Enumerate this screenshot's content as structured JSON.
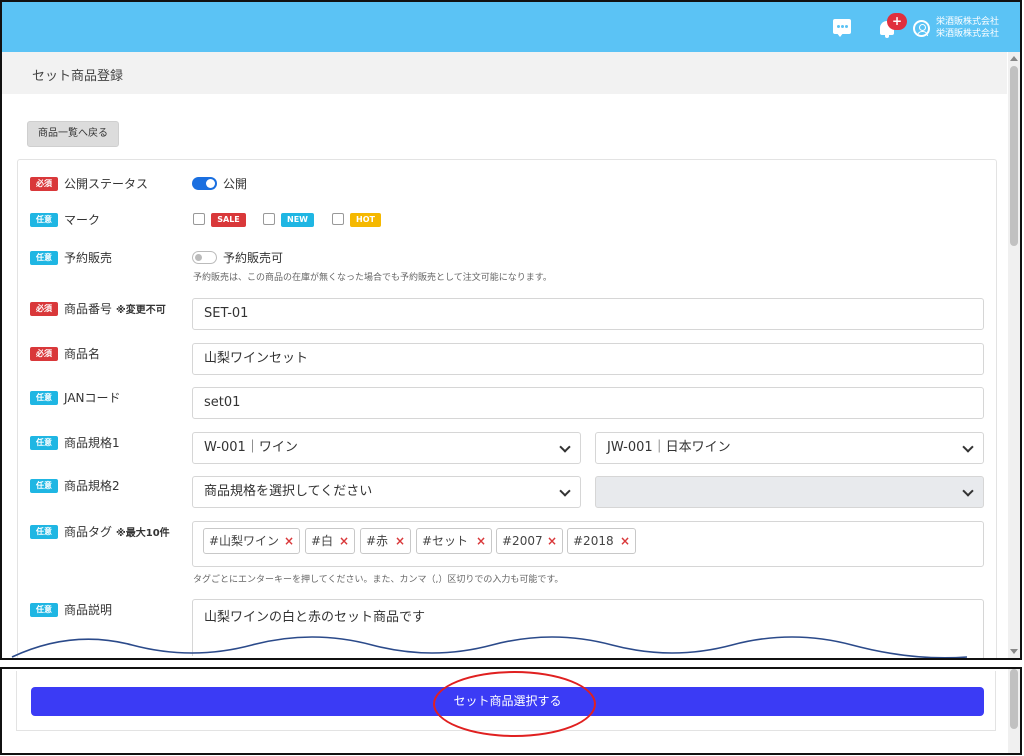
{
  "header": {
    "company_line1": "栄酒販株式会社",
    "company_line2": "栄酒販株式会社",
    "notification_badge": "+"
  },
  "page": {
    "title": "セット商品登録",
    "back_button": "商品一覧へ戻る"
  },
  "badges": {
    "required": "必須",
    "optional": "任意"
  },
  "form": {
    "status": {
      "label": "公開ステータス",
      "toggle_text": "公開",
      "enabled": true
    },
    "mark": {
      "label": "マーク",
      "options": [
        "SALE",
        "NEW",
        "HOT"
      ]
    },
    "preorder": {
      "label": "予約販売",
      "toggle_text": "予約販売可",
      "enabled": false,
      "help": "予約販売は、この商品の在庫が無くなった場合でも予約販売として注文可能になります。"
    },
    "product_code": {
      "label": "商品番号",
      "note": "※変更不可",
      "value": "SET-01"
    },
    "product_name": {
      "label": "商品名",
      "value": "山梨ワインセット"
    },
    "jan": {
      "label": "JANコード",
      "value": "set01"
    },
    "spec1": {
      "label": "商品規格1",
      "value1": "W-001｜ワイン",
      "value2": "JW-001｜日本ワイン"
    },
    "spec2": {
      "label": "商品規格2",
      "value1": "商品規格を選択してください",
      "value2": ""
    },
    "tags": {
      "label": "商品タグ",
      "note": "※最大10件",
      "items": [
        "#山梨ワイン",
        "#白",
        "#赤",
        "#セット",
        "#2007",
        "#2018"
      ],
      "remove": "×",
      "help": "タグごとにエンターキーを押してください。また、カンマ（,）区切りでの入力も可能です。"
    },
    "description": {
      "label": "商品説明",
      "value": "山梨ワインの白と赤のセット商品です"
    }
  },
  "footer": {
    "submit_button": "セット商品選択する"
  },
  "colors": {
    "header": "#5bc3f5",
    "required": "#d9383a",
    "optional": "#1fb6e3",
    "submit": "#3b3bf5",
    "annotation": "#e02020"
  }
}
